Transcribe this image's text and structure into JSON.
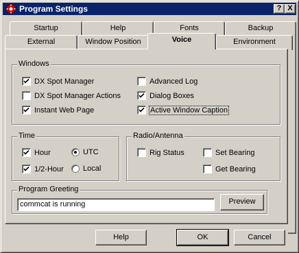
{
  "window": {
    "title": "Program Settings",
    "help_btn": "?",
    "close_btn": "X"
  },
  "tabs_back": [
    {
      "label": "Startup"
    },
    {
      "label": "Help"
    },
    {
      "label": "Fonts"
    },
    {
      "label": "Backup"
    }
  ],
  "tabs_front": [
    {
      "label": "External"
    },
    {
      "label": "Window Position"
    },
    {
      "label": "Voice",
      "active": true
    },
    {
      "label": "Environment"
    }
  ],
  "windows_group": {
    "label": "Windows",
    "items": [
      {
        "label": "DX Spot Manager",
        "checked": true
      },
      {
        "label": "DX Spot Manager Actions",
        "checked": false
      },
      {
        "label": "Instant Web Page",
        "checked": true
      },
      {
        "label": "Advanced Log",
        "checked": false
      },
      {
        "label": "Dialog Boxes",
        "checked": true
      },
      {
        "label": "Active Window Caption",
        "checked": true
      }
    ]
  },
  "time_group": {
    "label": "Time",
    "hour": {
      "label": "Hour",
      "checked": true
    },
    "half_hour": {
      "label": "1/2-Hour",
      "checked": true
    },
    "utc": {
      "label": "UTC",
      "selected": true
    },
    "local": {
      "label": "Local",
      "selected": false
    }
  },
  "radio_group": {
    "label": "Radio/Antenna",
    "rig_status": {
      "label": "Rig Status",
      "checked": false
    },
    "set_bearing": {
      "label": "Set Bearing",
      "checked": false
    },
    "get_bearing": {
      "label": "Get Bearing",
      "checked": false
    }
  },
  "greeting_group": {
    "label": "Program Greeting",
    "value": "commcat is running",
    "preview_label": "Preview"
  },
  "footer": {
    "help": "Help",
    "ok": "OK",
    "cancel": "Cancel"
  }
}
